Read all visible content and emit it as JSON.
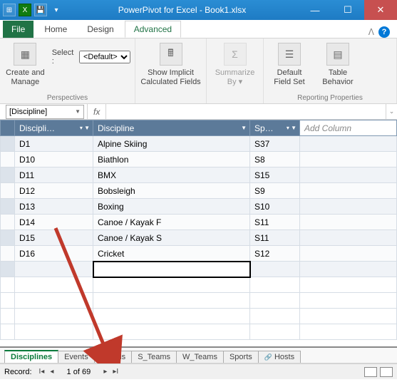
{
  "window": {
    "title": "PowerPivot for Excel - Book1.xlsx"
  },
  "ribbon": {
    "file": "File",
    "tabs": [
      "Home",
      "Design",
      "Advanced"
    ],
    "active_tab": "Advanced",
    "perspectives": {
      "create_manage": "Create and Manage",
      "select_label": "Select :",
      "select_value": "<Default>",
      "group_label": "Perspectives"
    },
    "show_implicit": "Show Implicit Calculated Fields",
    "summarize": "Summarize By",
    "reporting": {
      "default_fieldset": "Default Field Set",
      "table_behavior": "Table Behavior",
      "group_label": "Reporting Properties"
    }
  },
  "formula_bar": {
    "name": "[Discipline]",
    "fx": "fx",
    "value": ""
  },
  "grid": {
    "headers": {
      "id": "Discipli…",
      "discipline": "Discipline",
      "sport": "Sp…",
      "add": "Add Column"
    },
    "rows": [
      {
        "id": "D1",
        "discipline": "Alpine Skiing",
        "sport": "S37"
      },
      {
        "id": "D10",
        "discipline": "Biathlon",
        "sport": "S8"
      },
      {
        "id": "D11",
        "discipline": "BMX",
        "sport": "S15"
      },
      {
        "id": "D12",
        "discipline": "Bobsleigh",
        "sport": "S9"
      },
      {
        "id": "D13",
        "discipline": "Boxing",
        "sport": "S10"
      },
      {
        "id": "D14",
        "discipline": "Canoe / Kayak F",
        "sport": "S11"
      },
      {
        "id": "D15",
        "discipline": "Canoe / Kayak S",
        "sport": "S11"
      },
      {
        "id": "D16",
        "discipline": "Cricket",
        "sport": "S12"
      }
    ]
  },
  "sheet_tabs": [
    "Disciplines",
    "Events",
    "Medals",
    "S_Teams",
    "W_Teams",
    "Sports",
    "Hosts"
  ],
  "active_sheet": "Disciplines",
  "status": {
    "record_label": "Record:",
    "position": "1 of 69"
  }
}
